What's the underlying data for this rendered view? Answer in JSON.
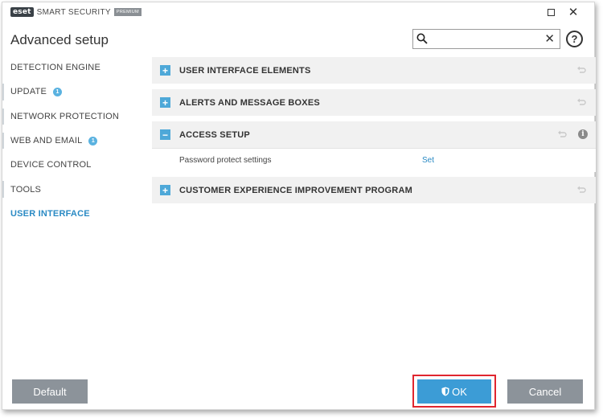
{
  "window": {
    "logo": "eset",
    "product_name": "SMART SECURITY",
    "edition_badge": "PREMIUM"
  },
  "header": {
    "title": "Advanced setup",
    "search": {
      "value": "",
      "placeholder": ""
    },
    "help_label": "?"
  },
  "sidebar": {
    "items": [
      {
        "label": "DETECTION ENGINE",
        "badge": ""
      },
      {
        "label": "UPDATE",
        "badge": "1"
      },
      {
        "label": "NETWORK PROTECTION",
        "badge": ""
      },
      {
        "label": "WEB AND EMAIL",
        "badge": "1"
      },
      {
        "label": "DEVICE CONTROL",
        "badge": ""
      },
      {
        "label": "TOOLS",
        "badge": ""
      },
      {
        "label": "USER INTERFACE",
        "badge": "",
        "active": true
      }
    ]
  },
  "content": {
    "sections": [
      {
        "title": "USER INTERFACE ELEMENTS",
        "expanded": false,
        "toggle": "+"
      },
      {
        "title": "ALERTS AND MESSAGE BOXES",
        "expanded": false,
        "toggle": "+"
      },
      {
        "title": "ACCESS SETUP",
        "expanded": true,
        "toggle": "−",
        "settings": [
          {
            "label": "Password protect settings",
            "action": "Set"
          }
        ]
      },
      {
        "title": "CUSTOMER EXPERIENCE IMPROVEMENT PROGRAM",
        "expanded": false,
        "toggle": "+"
      }
    ]
  },
  "footer": {
    "default_label": "Default",
    "ok_label": "OK",
    "cancel_label": "Cancel"
  },
  "colors": {
    "accent": "#3c9cd6",
    "toggle": "#4ea8d8",
    "active_nav": "#2a8ac4",
    "gray_button": "#8c939a",
    "highlight_outline": "#e0262f"
  },
  "icons": [
    "search-icon",
    "clear-icon",
    "help-icon",
    "maximize-icon",
    "close-icon",
    "revert-icon",
    "info-icon",
    "shield-icon"
  ]
}
